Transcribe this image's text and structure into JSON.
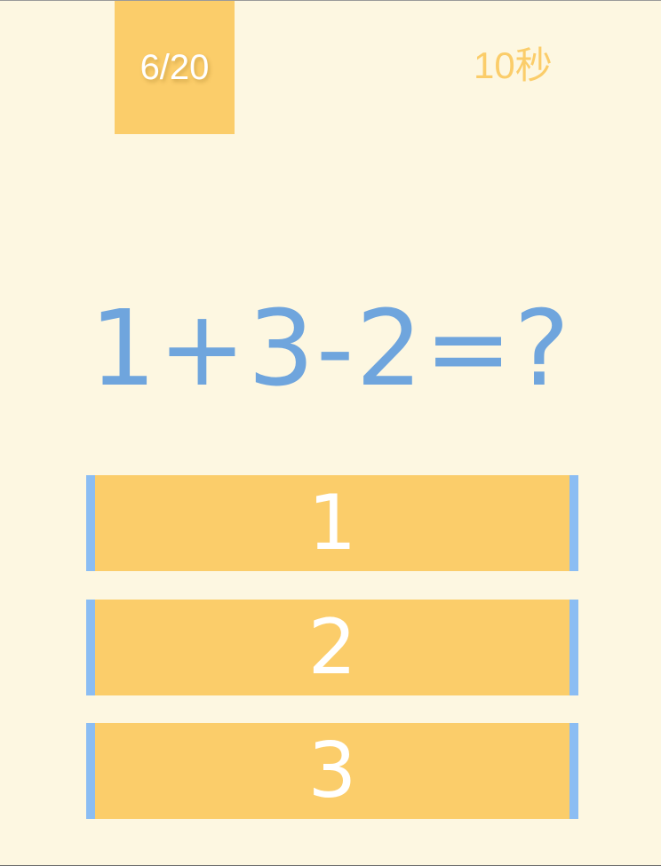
{
  "header": {
    "progress": "6/20",
    "timer": "10秒"
  },
  "question": {
    "text": "1+3-2=?"
  },
  "answers": [
    {
      "label": "1"
    },
    {
      "label": "2"
    },
    {
      "label": "3"
    }
  ],
  "colors": {
    "background": "#fdf7e1",
    "accent_yellow": "#fbcd6a",
    "accent_blue": "#8bbdf3",
    "question_blue": "#6fa5dd"
  }
}
